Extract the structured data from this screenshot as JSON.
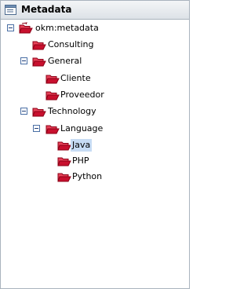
{
  "panel": {
    "title": "Metadata",
    "title_icon": "panel-window-icon"
  },
  "tree": {
    "root": {
      "label": "okm:metadata",
      "expanded": true
    },
    "consulting": {
      "label": "Consulting"
    },
    "general": {
      "label": "General",
      "expanded": true
    },
    "cliente": {
      "label": "Cliente"
    },
    "proveedor": {
      "label": "Proveedor"
    },
    "technology": {
      "label": "Technology",
      "expanded": true
    },
    "language": {
      "label": "Language",
      "expanded": true
    },
    "java": {
      "label": "Java",
      "selected": true
    },
    "php": {
      "label": "PHP"
    },
    "python": {
      "label": "Python"
    }
  },
  "colors": {
    "folder_red": "#c8102e",
    "selection": "#c7dcf4",
    "border": "#a9b3bd"
  }
}
